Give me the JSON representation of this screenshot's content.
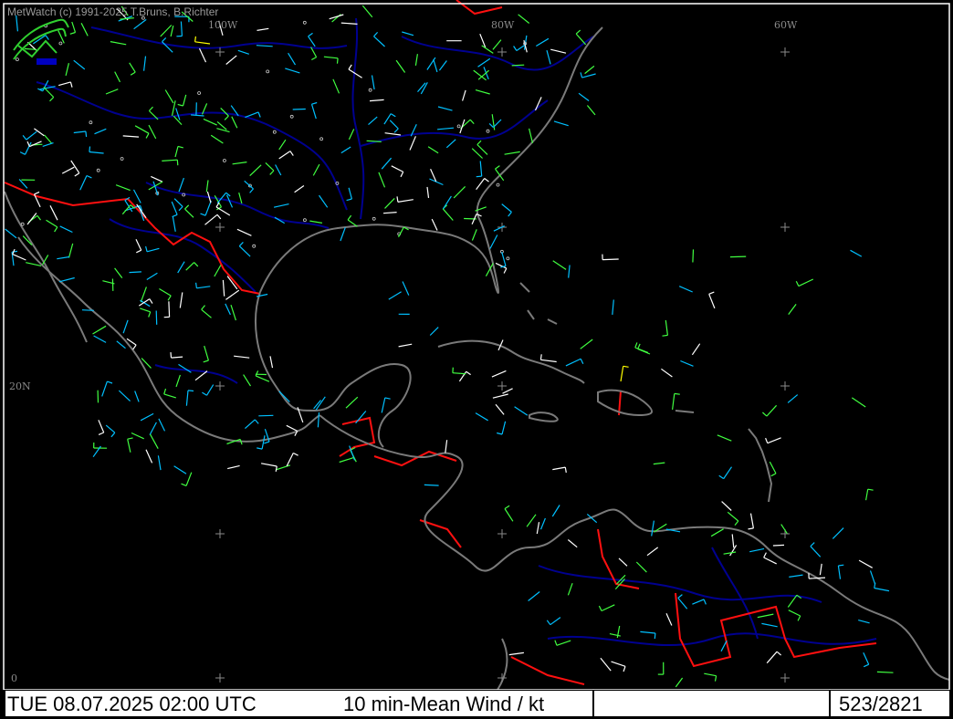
{
  "app": {
    "copyright": "MetWatch  (c) 1991-2025 T.Bruns, B.Richter"
  },
  "map": {
    "grid_labels": {
      "lon_100w": "100W",
      "lon_80w": "80W",
      "lon_60w": "60W",
      "lat_20n": "20N",
      "lat_0": "0"
    },
    "colors": {
      "background": "#000000",
      "coastline": "#808080",
      "border": "#ff0000",
      "river": "#000080",
      "grid_cross": "#808080",
      "wind_light": "#00c0ff",
      "wind_medium": "#40ff40",
      "wind_white": "#ffffff",
      "wind_yellow": "#ffff00"
    }
  },
  "status": {
    "datetime": "TUE 08.07.2025 02:00 UTC",
    "parameter": "10 min-Mean Wind / kt",
    "station_count": "523/2821"
  }
}
